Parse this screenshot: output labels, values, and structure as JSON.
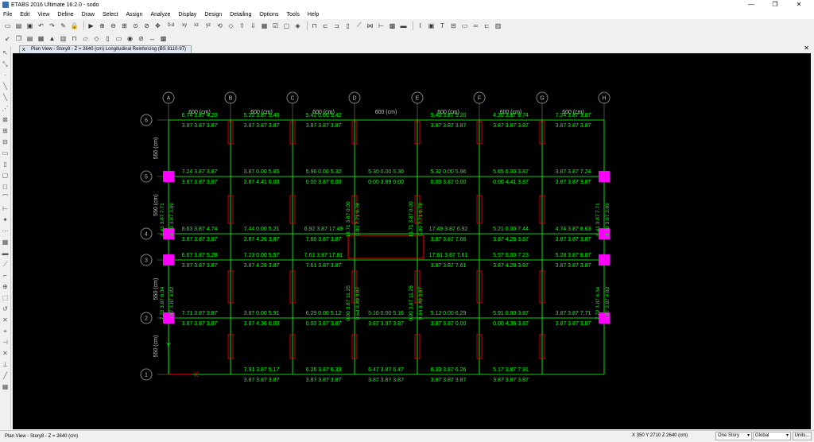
{
  "window": {
    "title": "ETABS 2016 Ultimate 16.2.0 - sodo",
    "controls": [
      "—",
      "❐",
      "✕"
    ]
  },
  "menu": [
    "File",
    "Edit",
    "View",
    "Define",
    "Draw",
    "Select",
    "Assign",
    "Analyze",
    "Display",
    "Design",
    "Detailing",
    "Options",
    "Tools",
    "Help"
  ],
  "toolbar": {
    "row1_icons": [
      "new-icon",
      "open-icon",
      "save-icon",
      "undo-icon",
      "redo-icon",
      "refresh-icon",
      "lock-icon",
      "run-icon",
      "zoom-in-icon",
      "zoom-out-icon",
      "zoom-window-icon",
      "zoom-fit-icon",
      "zoom-prev-icon",
      "pan-icon",
      "3d-view-icon",
      "plan-view-icon",
      "elevation-view-icon",
      "rotate-icon",
      "perspective-icon",
      "move-up-icon",
      "move-down-icon",
      "select-icon",
      "display-options-icon",
      "shrink-icon",
      "frame-icon",
      "wall-icon",
      "beam-icon",
      "column-icon",
      "brace-icon",
      "section-icon",
      "dimension-icon",
      "text-icon",
      "design-icon",
      "check-icon",
      "reinforcing-icon",
      "detailing-icon"
    ],
    "row1_labels": [
      "3-d",
      "xy",
      "xz",
      "yz"
    ]
  },
  "tab": {
    "title": "Plan View - Story8 - Z = 2640 (cm)  Longitudinal Reinforcing  (BS 8110-97)",
    "close": "x"
  },
  "canvas_close": "✕",
  "plan": {
    "grid_x": [
      "A",
      "B",
      "C",
      "D",
      "E",
      "F",
      "G",
      "H"
    ],
    "grid_y": [
      "6",
      "5",
      "4",
      "3",
      "2",
      "1"
    ],
    "x_spacing_label": "600 (cm)",
    "y_spacing_label": "550 (cm)",
    "axis_y_label": "Y",
    "axis_x_label": "X",
    "beam_values": [
      {
        "top": "6.74  3.87  4.20",
        "bot": "3.87  3.87  3.87"
      },
      {
        "top": "5.20  3.87  5.40",
        "bot": "3.87  3.87  3.87"
      },
      {
        "top": "5.42  0.00  5.42",
        "bot": "3.87  3.87  3.87"
      },
      {
        "top": "5.40  3.87  5.20",
        "bot": "3.87  3.87  3.87"
      },
      {
        "top": "4.20  3.87  6.74",
        "bot": "3.87  3.87  3.87"
      },
      {
        "top": "7.24  3.87  3.87",
        "bot": "3.87  3.87  3.87"
      },
      {
        "top": "3.87  0.00  5.65",
        "bot": "3.87  4.41  0.00"
      },
      {
        "top": "5.96  0.00  5.32",
        "bot": "0.00  3.87  0.00"
      },
      {
        "top": "5.30  0.00  5.30",
        "bot": "0.00  3.89  0.00"
      },
      {
        "top": "5.32  0.00  5.96",
        "bot": "0.00  3.87  0.00"
      },
      {
        "top": "5.65  0.00  3.87",
        "bot": "0.00  4.41  3.87"
      },
      {
        "top": "3.87  3.87  7.24",
        "bot": "3.87  3.87  3.87"
      },
      {
        "top": "8.63  3.87  4.74",
        "bot": "3.87  3.87  3.87"
      },
      {
        "top": "7.44  0.00  5.21",
        "bot": "3.87  4.26  3.87"
      },
      {
        "top": "6.92  3.87  17.49",
        "bot": "7.66  3.87  3.87"
      },
      {
        "top": "17.49  3.87  6.92",
        "bot": "3.87  3.87  7.66"
      },
      {
        "top": "5.21  0.00  7.44",
        "bot": "3.87  4.26  3.87"
      },
      {
        "top": "4.74  3.87  8.63",
        "bot": "3.87  3.87  3.87"
      },
      {
        "top": "6.67  3.87  5.28",
        "bot": "3.87  3.87  3.87"
      },
      {
        "top": "7.23  0.00  5.57",
        "bot": "3.87  4.28  3.87"
      },
      {
        "top": "7.61  3.87  17.61",
        "bot": "7.61  3.87  3.87"
      },
      {
        "top": "17.61  3.87  7.61",
        "bot": "3.87  3.87  7.61"
      },
      {
        "top": "5.57  0.00  7.23",
        "bot": "3.87  4.28  3.87"
      },
      {
        "top": "5.28  3.87  8.87",
        "bot": "3.87  3.87  3.87"
      },
      {
        "top": "7.71  3.87  3.87",
        "bot": "3.87  3.87  3.87"
      },
      {
        "top": "3.87  0.00  5.91",
        "bot": "3.87  4.36  0.00"
      },
      {
        "top": "6.29  0.00  5.12",
        "bot": "0.00  3.87  3.87"
      },
      {
        "top": "5.16  0.00  5.16",
        "bot": "3.87  3.97  3.87"
      },
      {
        "top": "5.12  0.00  6.29",
        "bot": "3.87  3.87  0.00"
      },
      {
        "top": "5.91  0.00  3.87",
        "bot": "0.00  4.36  3.87"
      },
      {
        "top": "3.87  3.87  7.71",
        "bot": "3.87  3.87  3.87"
      },
      {
        "top": "7.91  3.87  5.17",
        "bot": "3.87  3.87  3.87"
      },
      {
        "top": "6.26  3.87  6.33",
        "bot": "3.87  3.87  3.87"
      },
      {
        "top": "6.47  3.87  6.47",
        "bot": "3.87  3.87  3.87"
      },
      {
        "top": "6.33  3.87  6.26",
        "bot": "3.87  3.87  3.87"
      },
      {
        "top": "5.17  3.87  7.91",
        "bot": "3.87  3.87  3.87"
      }
    ],
    "vertical_beam_values": [
      "6.41  3.87  7.71",
      "4.79  3.87  3.89",
      "19.71  3.87  0.00",
      "0.00  7.71  9.78",
      "19.71  3.87  0.00",
      "0.00  7.71  9.78",
      "6.41  3.87  7.71",
      "4.79  3.87  3.89",
      "7.72  3.87  6.34",
      "3.87  3.87  4.82",
      "0.00  3.87  11.25",
      "9.64  8.49  3.87",
      "0.00  3.87  11.25",
      "9.64  8.49  3.87",
      "7.72  3.87  6.34",
      "3.87  3.87  4.82"
    ],
    "colors": {
      "background": "#000000",
      "grid": "#808080",
      "text": "#00ff00",
      "column": "#ff00ff",
      "wall": "#ff0000"
    }
  },
  "status": {
    "view": "Plan View - Story8 - Z = 2640 (cm)",
    "coords": "X 350  Y 2710  Z 2640 (cm)",
    "story_mode": "One Story",
    "coord_sys": "Global",
    "units_button": "Units..."
  }
}
